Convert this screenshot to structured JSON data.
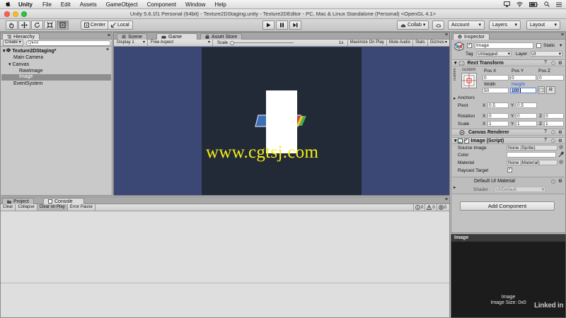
{
  "menubar": {
    "app_name": "Unity",
    "items": [
      "File",
      "Edit",
      "Assets",
      "GameObject",
      "Component",
      "Window",
      "Help"
    ]
  },
  "window": {
    "title": "Unity 5.6.1f1 Personal (64bit) - Texture2DStaging.unity - Texture2DEditor - PC, Mac & Linux Standalone (Personal) <OpenGL 4.1>"
  },
  "toolbar": {
    "center_label": "Center",
    "local_label": "Local",
    "collab_label": "Collab",
    "account_label": "Account",
    "layers_label": "Layers",
    "layout_label": "Layout"
  },
  "hierarchy": {
    "tab_label": "Hierarchy",
    "create_label": "Create",
    "search_placeholder": "Q▾All",
    "scene_name": "Texture2DStaging*",
    "items": [
      "Main Camera",
      "Canvas",
      "RawImage",
      "Image",
      "EventSystem"
    ]
  },
  "scene_tabs": [
    "Scene",
    "Game",
    "Asset Store"
  ],
  "game_bar": {
    "display": "Display 1",
    "aspect": "Free Aspect",
    "scale_label": "Scale",
    "scale_value": "1x",
    "maximize": "Maximize On Play",
    "mute": "Mute Audio",
    "stats": "Stats",
    "gizmos": "Gizmos"
  },
  "watermark": "www.cgtsj.com",
  "bottom_tabs": [
    "Project",
    "Console"
  ],
  "console": {
    "buttons": [
      "Clear",
      "Collapse",
      "Clear on Play",
      "Error Pause"
    ],
    "counts": [
      "0",
      "0",
      "0"
    ]
  },
  "inspector": {
    "tab_label": "Inspector",
    "object_name": "Image",
    "static_label": "Static",
    "tag_label": "Tag",
    "tag_value": "Untagged",
    "layer_label": "Layer",
    "layer_value": "UI",
    "rect_transform": {
      "title": "Rect Transform",
      "anchor_preset": "custom",
      "side_label": "custom",
      "pos_x_label": "Pos X",
      "pos_y_label": "Pos Y",
      "pos_z_label": "Pos Z",
      "pos_x": "0",
      "pos_y": "0",
      "pos_z": "0",
      "width_label": "Width",
      "height_label": "Height",
      "width": "50",
      "height": "100",
      "r_button": "R",
      "anchors_label": "Anchors",
      "pivot_label": "Pivot",
      "pivot_x": "0.5",
      "pivot_y": "0.5",
      "rotation_label": "Rotation",
      "rot_x": "0",
      "rot_y": "0",
      "rot_z": "0",
      "scale_label": "Scale",
      "scale_x": "1",
      "scale_y": "1",
      "scale_z": "1",
      "x_axis": "X",
      "y_axis": "Y",
      "z_axis": "Z"
    },
    "canvas_renderer_title": "Canvas Renderer",
    "image_script": {
      "title": "Image (Script)",
      "source_image_label": "Source Image",
      "source_image_value": "None (Sprite)",
      "color_label": "Color",
      "material_label": "Material",
      "material_value": "None (Material)",
      "raycast_label": "Raycast Target",
      "raycast_check": "✓"
    },
    "material_name": "Default UI Material",
    "shader_label": "Shader",
    "shader_value": "UI/Default",
    "add_component": "Add Component",
    "preview_tab": "Image",
    "preview_title": "Image",
    "preview_size": "Image Size: 0x0"
  },
  "logo": "Linked in"
}
